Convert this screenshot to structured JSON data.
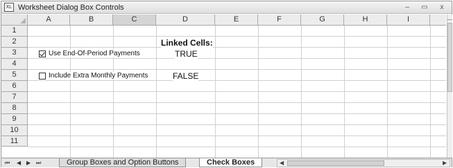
{
  "window": {
    "title": "Worksheet Dialog Box Controls",
    "icon": "excel-workbook-icon",
    "minimize_glyph": "–",
    "restore_glyph": "▭",
    "close_glyph": "x"
  },
  "columns": [
    "A",
    "B",
    "C",
    "D",
    "E",
    "F",
    "G",
    "H",
    "I"
  ],
  "active_column": "C",
  "rows": [
    "1",
    "2",
    "3",
    "4",
    "5",
    "6",
    "7",
    "8",
    "9",
    "10",
    "11"
  ],
  "controls": {
    "checkbox1": {
      "label": "Use End-Of-Period Payments",
      "checked": true
    },
    "checkbox2": {
      "label": "Include Extra Monthly Payments",
      "checked": false
    }
  },
  "linked": {
    "title": "Linked Cells:",
    "value1": "TRUE",
    "value2": "FALSE"
  },
  "sheet_tabs": {
    "nav_first": "⏮",
    "nav_prev": "◀",
    "nav_next": "▶",
    "nav_last": "⏭",
    "tabs": [
      "Group Boxes and Option Buttons",
      "Check Boxes"
    ],
    "active_tab": "Check Boxes"
  },
  "colors": {
    "grid_line": "#d0d0d0",
    "header_bg": "#ececec",
    "active_header_bg": "#d4d4d4"
  }
}
